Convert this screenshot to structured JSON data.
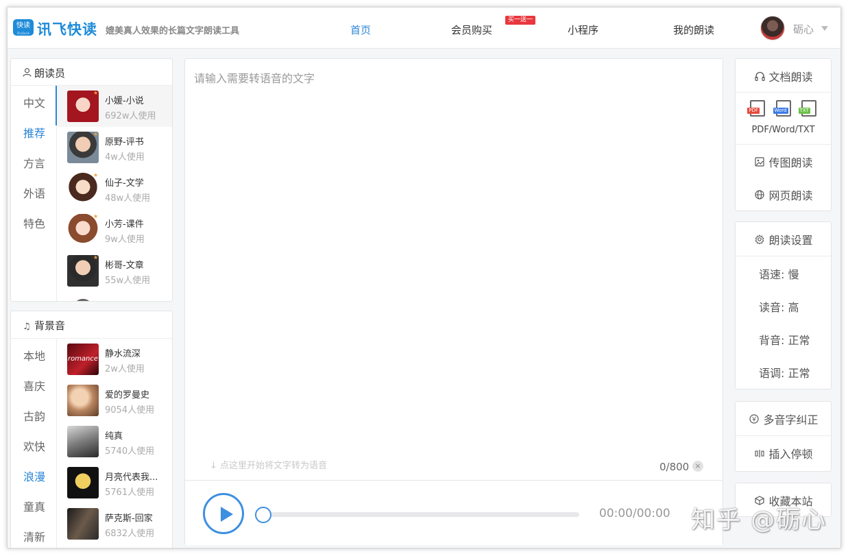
{
  "header": {
    "logo_text": "快读",
    "logo_sub": "iFlyQuick",
    "brand": "讯飞快读",
    "slogan": "媲美真人效果的长篇文字朗读工具",
    "nav": [
      {
        "label": "首页",
        "active": true
      },
      {
        "label": "会员购买",
        "active": false
      },
      {
        "label": "小程序",
        "active": false
      },
      {
        "label": "我的朗读",
        "active": false
      }
    ],
    "promo_badge": "买一送一",
    "username": "砺心"
  },
  "readers": {
    "title": "朗读员",
    "categories": [
      "中文",
      "推荐",
      "方言",
      "外语",
      "特色"
    ],
    "active_category": "推荐",
    "voices": [
      {
        "name": "小媛-小说",
        "count": "692w人使用"
      },
      {
        "name": "原野-评书",
        "count": "4w人使用"
      },
      {
        "name": "仙子-文学",
        "count": "48w人使用"
      },
      {
        "name": "小芳-课件",
        "count": "9w人使用"
      },
      {
        "name": "彬哥-文章",
        "count": "55w人使用"
      }
    ]
  },
  "bgm": {
    "title": "背景音",
    "categories": [
      "本地",
      "喜庆",
      "古韵",
      "欢快",
      "浪漫",
      "童真",
      "清新"
    ],
    "active_category": "浪漫",
    "tracks": [
      {
        "name": "静水流深",
        "count": "2w人使用",
        "cover_text": "romance"
      },
      {
        "name": "爱的罗曼史",
        "count": "9054人使用"
      },
      {
        "name": "纯真",
        "count": "5740人使用"
      },
      {
        "name": "月亮代表我...",
        "count": "5761人使用"
      },
      {
        "name": "萨克斯-回家",
        "count": "6832人使用"
      }
    ]
  },
  "editor": {
    "placeholder": "请输入需要转语音的文字",
    "value": "",
    "hint": "↓ 点这里开始将文字转为语音",
    "counter": "0/800",
    "clear": "×"
  },
  "player": {
    "time": "00:00/00:00",
    "progress": 0
  },
  "tools": {
    "doc_read": "文档朗读",
    "file_badges": [
      "PDF",
      "Word",
      "TXT"
    ],
    "file_types": "PDF/Word/TXT",
    "image_read": "传图朗读",
    "web_read": "网页朗读"
  },
  "settings": {
    "title": "朗读设置",
    "speed": "语速: 慢",
    "volume": "读音: 高",
    "bg_volume": "背音: 正常",
    "pitch": "语调: 正常"
  },
  "extras": {
    "polyphone": "多音字纠正",
    "pause": "插入停顿",
    "favorite": "收藏本站"
  },
  "watermark": "知乎 @砺心",
  "colors": {
    "accent": "#2b86d6",
    "player": "#3d8fe0",
    "badge": "#e8383d"
  }
}
